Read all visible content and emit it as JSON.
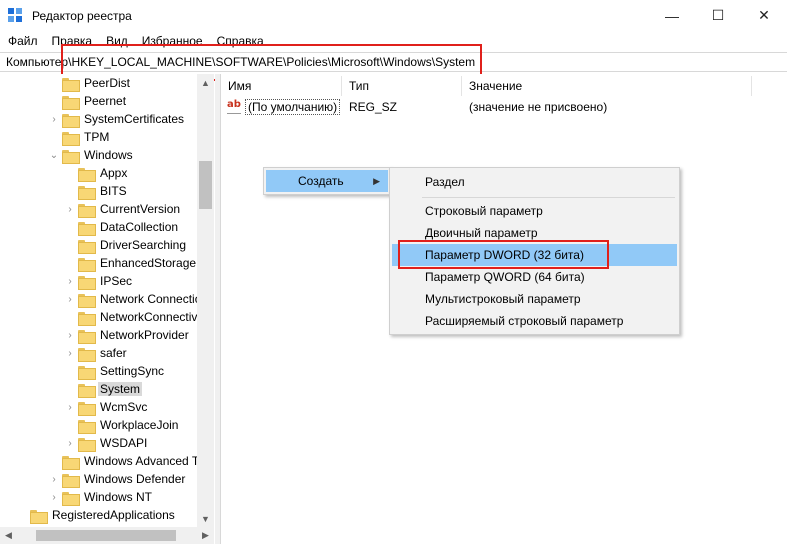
{
  "window": {
    "title": "Редактор реестра",
    "buttons": {
      "minimize": "—",
      "maximize": "☐",
      "close": "✕"
    }
  },
  "menu": [
    "Файл",
    "Правка",
    "Вид",
    "Избранное",
    "Справка"
  ],
  "address": {
    "path": "Компьютер\\HKEY_LOCAL_MACHINE\\SOFTWARE\\Policies\\Microsoft\\Windows\\System"
  },
  "tree": [
    {
      "label": "PeerDist",
      "expander": ""
    },
    {
      "label": "Peernet",
      "expander": ""
    },
    {
      "label": "SystemCertificates",
      "expander": "›"
    },
    {
      "label": "TPM",
      "expander": ""
    },
    {
      "label": "Windows",
      "expander": "⌄"
    },
    {
      "label": "Appx",
      "expander": ""
    },
    {
      "label": "BITS",
      "expander": ""
    },
    {
      "label": "CurrentVersion",
      "expander": "›"
    },
    {
      "label": "DataCollection",
      "expander": ""
    },
    {
      "label": "DriverSearching",
      "expander": ""
    },
    {
      "label": "EnhancedStorageD",
      "expander": ""
    },
    {
      "label": "IPSec",
      "expander": "›"
    },
    {
      "label": "Network Connectio",
      "expander": "›"
    },
    {
      "label": "NetworkConnectivi",
      "expander": ""
    },
    {
      "label": "NetworkProvider",
      "expander": "›"
    },
    {
      "label": "safer",
      "expander": "›"
    },
    {
      "label": "SettingSync",
      "expander": ""
    },
    {
      "label": "System",
      "expander": "",
      "selected": true
    },
    {
      "label": "WcmSvc",
      "expander": "›"
    },
    {
      "label": "WorkplaceJoin",
      "expander": ""
    },
    {
      "label": "WSDAPI",
      "expander": "›"
    },
    {
      "label": "Windows Advanced T",
      "expander": ""
    },
    {
      "label": "Windows Defender",
      "expander": "›"
    },
    {
      "label": "Windows NT",
      "expander": "›"
    },
    {
      "label": "RegisteredApplications",
      "expander": ""
    }
  ],
  "columns": {
    "name": "Имя",
    "type": "Тип",
    "value": "Значение"
  },
  "values": [
    {
      "name": "(По умолчанию)",
      "type": "REG_SZ",
      "data": "(значение не присвоено)"
    }
  ],
  "context_menu": {
    "create_label": "Создать",
    "submenu": [
      "Раздел",
      "Строковый параметр",
      "Двоичный параметр",
      "Параметр DWORD (32 бита)",
      "Параметр QWORD (64 бита)",
      "Мультистроковый параметр",
      "Расширяемый строковый параметр"
    ]
  },
  "colors": {
    "highlight": "#91c9f7",
    "annotation": "#e0201b",
    "selection": "#d9d9d9"
  },
  "icons": {
    "app": "regedit-icon",
    "folder": "folder-icon",
    "value": "string-value-icon"
  }
}
